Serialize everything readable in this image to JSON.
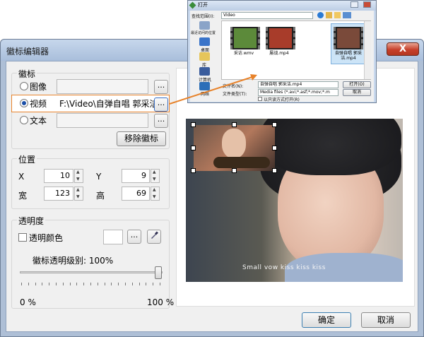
{
  "dialog": {
    "title": "徽标编辑器",
    "close_label": "X",
    "ok_label": "确定",
    "cancel_label": "取消"
  },
  "logo_group": {
    "title": "徽标",
    "options": [
      {
        "label": "图像",
        "selected": false
      },
      {
        "label": "视频",
        "selected": true
      },
      {
        "label": "文本",
        "selected": false
      }
    ],
    "video_path": "F:\\Video\\自弹自唱 郭采洁",
    "browse_label": "...",
    "remove_label": "移除徽标"
  },
  "position_group": {
    "title": "位置",
    "x_label": "X",
    "x_value": "10",
    "y_label": "Y",
    "y_value": "9",
    "width_label": "宽",
    "width_value": "123",
    "height_label": "高",
    "height_value": "69"
  },
  "transparency_group": {
    "title": "透明度",
    "transparent_color_label": "透明颜色",
    "transparent_color_checked": false,
    "level_label": "徽标透明级别: 100%",
    "level_value_percent": 100,
    "min_label": "0 %",
    "max_label": "100 %"
  },
  "preview": {
    "subtitle": "Small vow kiss kiss kiss"
  },
  "open_dialog": {
    "title": "打开",
    "look_in_label": "查找范围(I):",
    "look_in_value": "Video",
    "sidebar": [
      "最近访问的位置",
      "桌面",
      "库",
      "计算机",
      "网络"
    ],
    "files": [
      {
        "name": "采访.wmv"
      },
      {
        "name": "屡战.mp4"
      },
      {
        "name": "自弹自唱 郭采洁.mp4"
      }
    ],
    "filename_label": "文件名(N):",
    "filename_value": "自弹自唱 郭采洁.mp4",
    "filetype_label": "文件类型(T):",
    "filetype_value": "Media files (*.avi;*.asf;*.mov;*.m",
    "readonly_label": "以只读方式打开(R)",
    "open_label": "打开(O)",
    "cancel_label": "取消"
  },
  "colors": {
    "accent_arrow": "#e7822a",
    "title_bar": "#b8cbe4",
    "close_red": "#c7402b"
  }
}
